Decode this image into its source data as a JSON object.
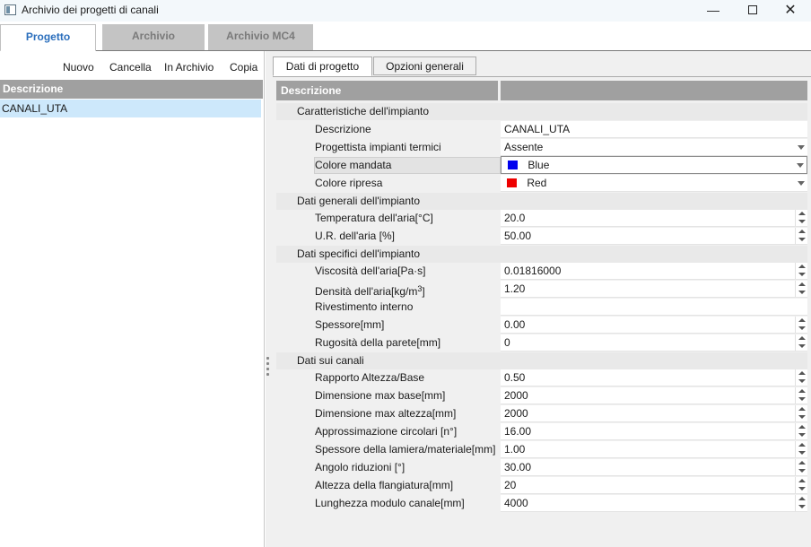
{
  "window": {
    "title": "Archivio dei progetti di canali",
    "min_glyph": "—",
    "close_glyph": "✕"
  },
  "top_tabs": [
    "Progetto",
    "Archivio",
    "Archivio MC4"
  ],
  "left": {
    "toolbar": {
      "new": "Nuovo",
      "delete": "Cancella",
      "archive": "In Archivio",
      "copy": "Copia"
    },
    "header": "Descrizione",
    "rows": [
      "CANALI_UTA"
    ]
  },
  "right": {
    "tabs": [
      "Dati di progetto",
      "Opzioni generali"
    ],
    "grid_header": "Descrizione",
    "categories": {
      "impianto": "Caratteristiche dell'impianto",
      "generali": "Dati generali dell'impianto",
      "specifici": "Dati specifici dell'impianto",
      "canali": "Dati sui canali"
    },
    "props": {
      "descrizione": {
        "label": "Descrizione",
        "value": "CANALI_UTA"
      },
      "progettista": {
        "label": "Progettista impianti termici",
        "value": "Assente"
      },
      "colore_mandata": {
        "label": "Colore mandata",
        "value": "Blue",
        "color": "#0000ee"
      },
      "colore_ripresa": {
        "label": "Colore ripresa",
        "value": "Red",
        "color": "#ee0000"
      },
      "temperatura": {
        "label": "Temperatura dell'aria[°C]",
        "value": "20.0"
      },
      "ur": {
        "label": "U.R. dell'aria [%]",
        "value": "50.00"
      },
      "viscosita": {
        "label": "Viscosità dell'aria[Pa·s]",
        "value": "0.01816000"
      },
      "densita": {
        "label_main": "Densità dell'aria[kg/m",
        "label_sup": "3",
        "label_end": "]",
        "value": "1.20"
      },
      "rivestimento": {
        "label": "Rivestimento interno",
        "value": ""
      },
      "spessore": {
        "label": "Spessore[mm]",
        "value": "0.00"
      },
      "rugosita": {
        "label": "Rugosità della parete[mm]",
        "value": "0"
      },
      "rapporto": {
        "label": "Rapporto Altezza/Base",
        "value": "0.50"
      },
      "dim_base": {
        "label": "Dimensione max base[mm]",
        "value": "2000"
      },
      "dim_altezza": {
        "label": "Dimensione max altezza[mm]",
        "value": "2000"
      },
      "approssimazione": {
        "label": "Approssimazione circolari [n°]",
        "value": "16.00"
      },
      "spessore_lamiera": {
        "label": "Spessore della lamiera/materiale[mm]",
        "value": "1.00"
      },
      "angolo": {
        "label": "Angolo riduzioni [°]",
        "value": "30.00"
      },
      "flangiatura": {
        "label": "Altezza della flangiatura[mm]",
        "value": "20"
      },
      "lunghezza": {
        "label": "Lunghezza modulo canale[mm]",
        "value": "4000"
      }
    }
  },
  "colors": {
    "accent": "#2a6ebc",
    "selection": "#cde8fb",
    "header": "#a0a0a0"
  }
}
